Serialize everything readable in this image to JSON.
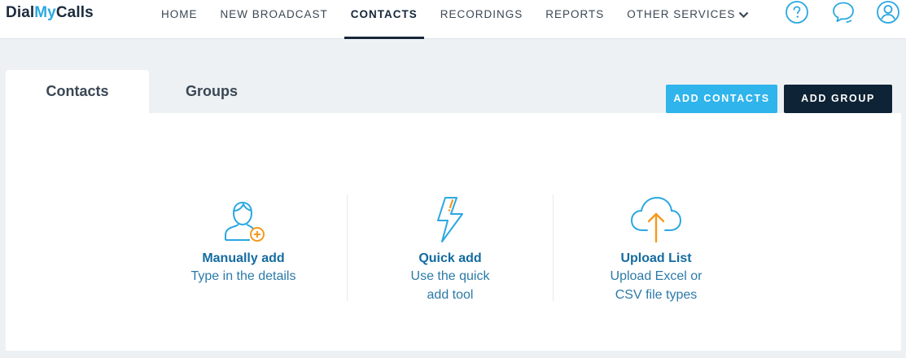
{
  "app": {
    "logo_part1": "Dial",
    "logo_part2": "My",
    "logo_part3": "Calls"
  },
  "nav": {
    "items": [
      {
        "label": "HOME",
        "active": false
      },
      {
        "label": "NEW BROADCAST",
        "active": false
      },
      {
        "label": "CONTACTS",
        "active": true
      },
      {
        "label": "RECORDINGS",
        "active": false
      },
      {
        "label": "REPORTS",
        "active": false
      },
      {
        "label": "OTHER SERVICES",
        "active": false,
        "has_dropdown": true
      }
    ],
    "icons": [
      "help-icon",
      "chat-icon",
      "user-account-icon"
    ]
  },
  "tabs": [
    {
      "label": "Contacts",
      "active": true
    },
    {
      "label": "Groups",
      "active": false
    }
  ],
  "actions": {
    "add_contacts": "ADD CONTACTS",
    "add_group": "ADD GROUP"
  },
  "options": [
    {
      "icon": "add-person-icon",
      "title": "Manually add",
      "desc_line1": "Type in the details",
      "desc_line2": ""
    },
    {
      "icon": "lightning-icon",
      "title": "Quick add",
      "desc_line1": "Use the quick",
      "desc_line2": "add tool"
    },
    {
      "icon": "cloud-upload-icon",
      "title": "Upload List",
      "desc_line1": "Upload Excel or",
      "desc_line2": "CSV file types"
    }
  ],
  "colors": {
    "brand_dark": "#16273a",
    "brand_blue": "#2aa8e0",
    "accent_orange": "#f39a1e",
    "link_blue": "#146ba0",
    "button_light": "#2fb4ec",
    "button_dark": "#0f2336"
  }
}
